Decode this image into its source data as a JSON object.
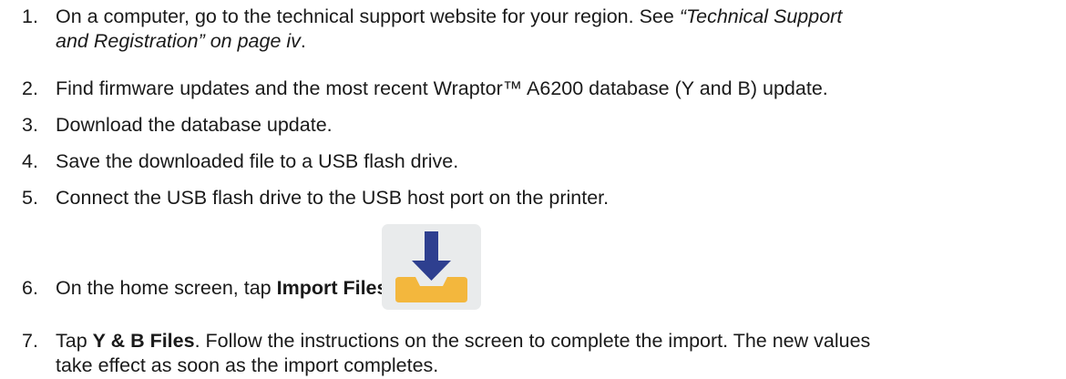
{
  "steps": [
    {
      "num": "1.",
      "pre": "On a computer, go to the technical support website for your region. See ",
      "link_line1": "“Technical Support",
      "link_line2": "and Registration” on page iv",
      "post": "."
    },
    {
      "num": "2.",
      "text": "Find firmware updates and the most recent Wraptor™ A6200 database (Y and B) update."
    },
    {
      "num": "3.",
      "text": "Download the database update."
    },
    {
      "num": "4.",
      "text": "Save the downloaded file to a USB flash drive."
    },
    {
      "num": "5.",
      "text": "Connect the USB flash drive to the USB host port on the printer."
    },
    {
      "num": "6.",
      "pre": "On the home screen, tap ",
      "bold": "Import Files",
      "post": ".",
      "icon": "import-files-icon"
    },
    {
      "num": "7.",
      "pre": "Tap ",
      "bold": "Y & B Files",
      "line1_rest": ". Follow the instructions on the screen to complete the import. The new values",
      "line2": "take effect as soon as the import completes."
    }
  ],
  "colors": {
    "text": "#1a1a1a",
    "icon_background": "#e9ebec",
    "arrow": "#2e3f8f",
    "tray": "#f3b73d"
  }
}
